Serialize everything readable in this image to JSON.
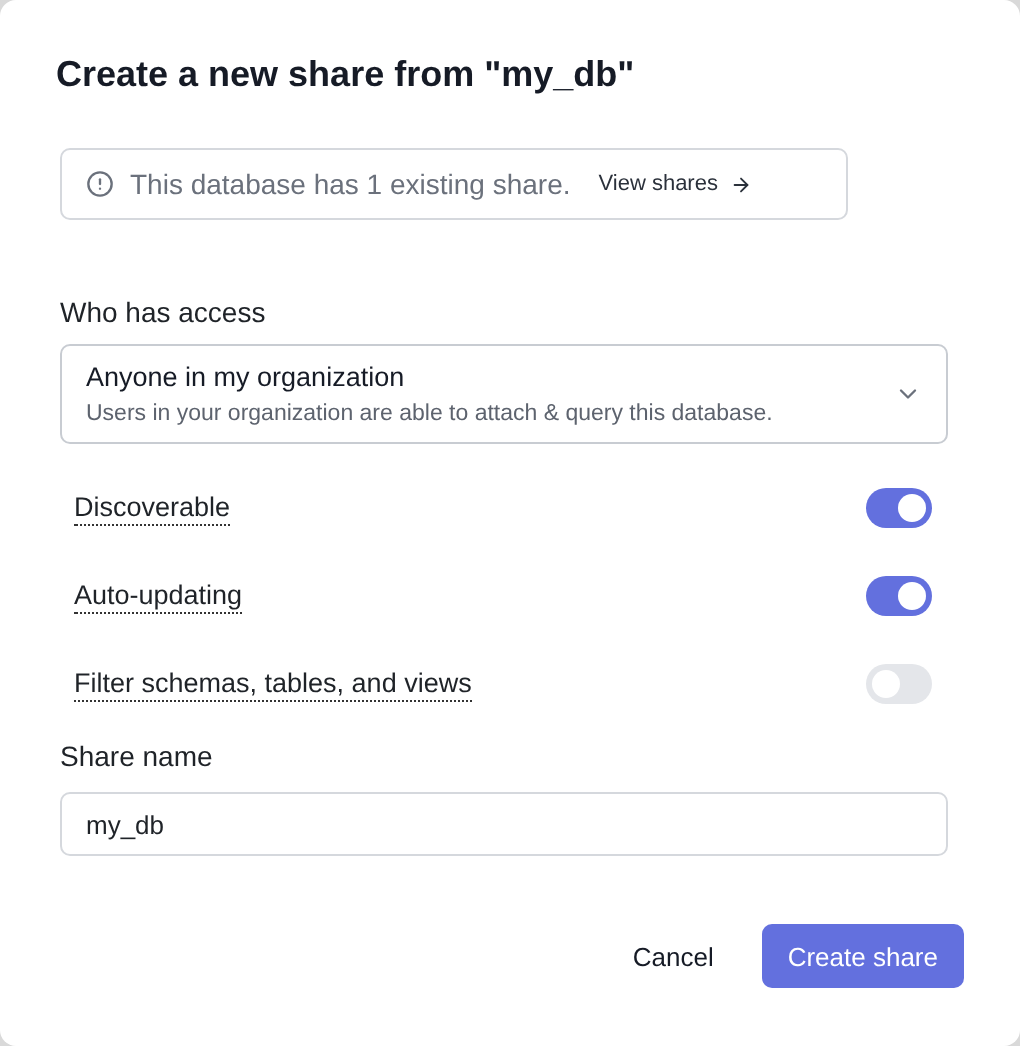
{
  "dialog": {
    "title": "Create a new share from \"my_db\""
  },
  "notice": {
    "text": "This database has 1 existing share.",
    "link": "View shares"
  },
  "access": {
    "label": "Who has access",
    "value": "Anyone in my organization",
    "description": "Users in your organization are able to attach & query this database."
  },
  "options": [
    {
      "label": "Discoverable",
      "on": true
    },
    {
      "label": "Auto-updating",
      "on": true
    },
    {
      "label": "Filter schemas, tables, and views",
      "on": false
    }
  ],
  "share_name": {
    "label": "Share name",
    "value": "my_db"
  },
  "buttons": {
    "cancel": "Cancel",
    "submit": "Create share"
  }
}
